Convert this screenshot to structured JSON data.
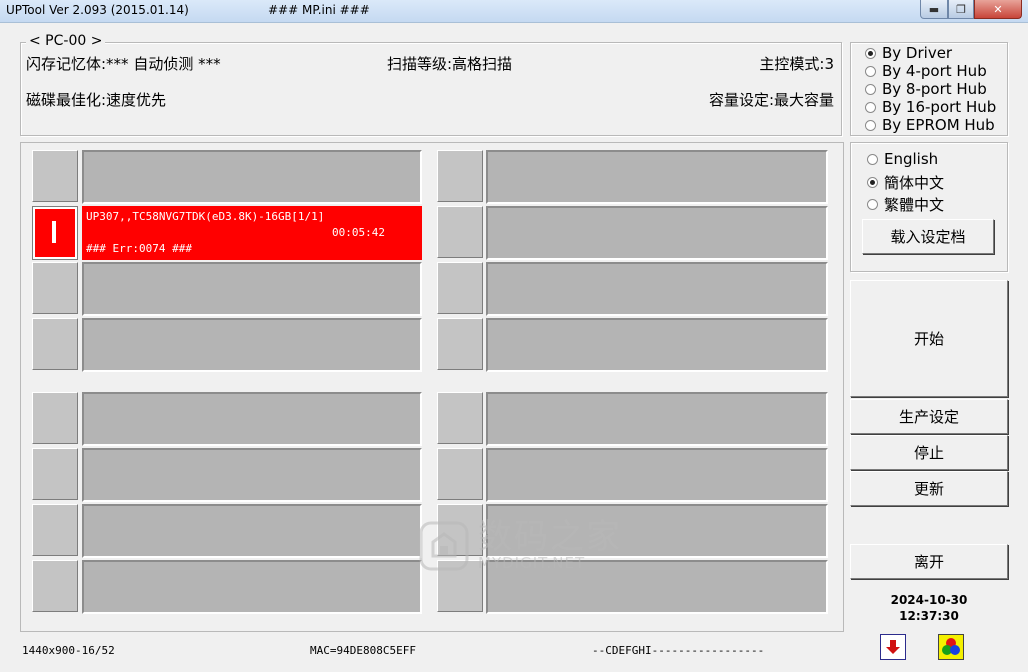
{
  "window": {
    "title": "UPTool Ver 2.093 (2015.01.14)",
    "ini": "### MP.ini ###",
    "minimize": "▬",
    "maximize": "❐",
    "close": "✕"
  },
  "pc": {
    "legend": "< PC-00 >",
    "flash_memory": "闪存记忆体:*** 自动侦测 ***",
    "scan_level": "扫描等级:高格扫描",
    "controller_mode": "主控模式:3",
    "disk_optimize": "磁碟最佳化:速度优先",
    "capacity": "容量设定:最大容量"
  },
  "hub_options": [
    {
      "label": "By Driver",
      "selected": true
    },
    {
      "label": "By 4-port Hub",
      "selected": false
    },
    {
      "label": "By 8-port Hub",
      "selected": false
    },
    {
      "label": "By 16-port Hub",
      "selected": false
    },
    {
      "label": "By EPROM Hub",
      "selected": false
    }
  ],
  "language_options": [
    {
      "label": "English",
      "selected": false
    },
    {
      "label": "簡体中文",
      "selected": true
    },
    {
      "label": "繁體中文",
      "selected": false
    }
  ],
  "buttons": {
    "load_settings": "载入设定档",
    "start": "开始",
    "production_settings": "生产设定",
    "stop": "停止",
    "refresh": "更新",
    "exit": "离开"
  },
  "active_slot": {
    "line1": "UP307,,TC58NVG7TDK(eD3.8K)-16GB[1/1]",
    "line2": "00:05:42",
    "line3": "### Err:0074 ###",
    "color": "#ff0000"
  },
  "datetime": {
    "date": "2024-10-30",
    "time": "12:37:30"
  },
  "status": {
    "resolution": "1440x900-16/52",
    "mac": "MAC=94DE808C5EFF",
    "drives": "--CDEFGHI-----------------"
  },
  "watermark": {
    "cn": "数码之家",
    "en": "MYDIGIT.NET"
  },
  "icons": [
    "down-arrow-icon",
    "color-circles-icon"
  ]
}
